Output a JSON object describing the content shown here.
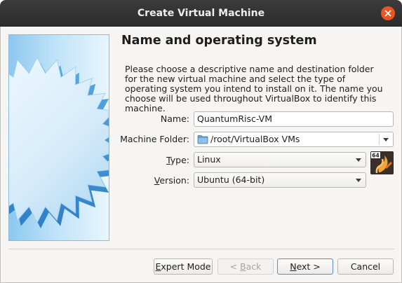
{
  "window": {
    "title": "Create Virtual Machine"
  },
  "page": {
    "heading": "Name and operating system",
    "description": "Please choose a descriptive name and destination folder for the new virtual machine and select the type of operating system you intend to install on it. The name you choose will be used throughout VirtualBox to identify this machine."
  },
  "form": {
    "name": {
      "label": "Name:",
      "value": "QuantumRisc-VM"
    },
    "folder": {
      "label": "Machine Folder:",
      "value": "/root/VirtualBox VMs",
      "icon": "folder-icon"
    },
    "type": {
      "label_first": "T",
      "label_rest": "ype:",
      "value": "Linux"
    },
    "version": {
      "label_first": "V",
      "label_rest": "ersion:",
      "value": "Ubuntu (64-bit)"
    },
    "os_icon": {
      "name": "ubuntu-64-os-icon",
      "badge": "64"
    }
  },
  "buttons": {
    "expert": {
      "first": "E",
      "rest": "xpert Mode"
    },
    "back": {
      "prefix": "< ",
      "first": "B",
      "rest": "ack"
    },
    "next": {
      "first": "N",
      "rest": "ext >"
    },
    "cancel": "Cancel"
  },
  "colors": {
    "titlebar": "#2c2c2c",
    "close": "#e95420",
    "accent": "#5f8ac4"
  }
}
